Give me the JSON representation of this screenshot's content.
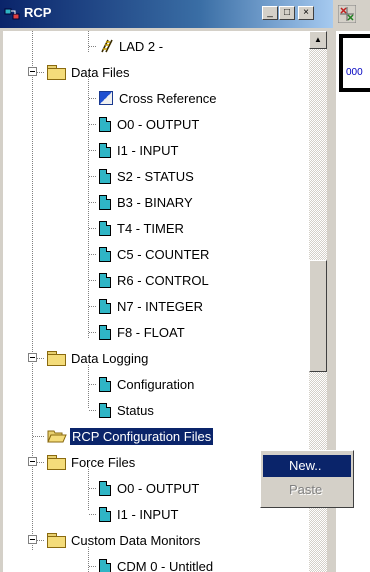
{
  "window": {
    "title": "RCP",
    "minimize_label": "_",
    "maximize_label": "□",
    "close_label": "×"
  },
  "tree": {
    "items": [
      {
        "label": "LAD 2 -",
        "icon": "ladder-icon"
      },
      {
        "label": "Data Files",
        "icon": "folder-icon"
      },
      {
        "label": "Cross Reference",
        "icon": "cross-reference-icon"
      },
      {
        "label": "O0 - OUTPUT",
        "icon": "data-file-icon"
      },
      {
        "label": "I1 - INPUT",
        "icon": "data-file-icon"
      },
      {
        "label": "S2 - STATUS",
        "icon": "data-file-icon"
      },
      {
        "label": "B3 - BINARY",
        "icon": "data-file-icon"
      },
      {
        "label": "T4 - TIMER",
        "icon": "data-file-icon"
      },
      {
        "label": "C5 - COUNTER",
        "icon": "data-file-icon"
      },
      {
        "label": "R6 - CONTROL",
        "icon": "data-file-icon"
      },
      {
        "label": "N7 - INTEGER",
        "icon": "data-file-icon"
      },
      {
        "label": "F8 - FLOAT",
        "icon": "data-file-icon"
      },
      {
        "label": "Data Logging",
        "icon": "folder-icon"
      },
      {
        "label": "Configuration",
        "icon": "data-file-icon"
      },
      {
        "label": "Status",
        "icon": "data-file-icon"
      },
      {
        "label": "RCP Configuration Files",
        "icon": "open-folder-icon"
      },
      {
        "label": "Force Files",
        "icon": "folder-icon"
      },
      {
        "label": "O0 - OUTPUT",
        "icon": "data-file-icon"
      },
      {
        "label": "I1 - INPUT",
        "icon": "data-file-icon"
      },
      {
        "label": "Custom Data Monitors",
        "icon": "folder-icon"
      },
      {
        "label": "CDM 0 - Untitled",
        "icon": "data-file-icon"
      }
    ]
  },
  "right_panel": {
    "address_text": "000"
  },
  "context_menu": {
    "items": [
      {
        "label": "New..",
        "enabled": true,
        "highlighted": true
      },
      {
        "label": "Paste",
        "enabled": false
      }
    ]
  },
  "colors": {
    "selection": "#0a246a",
    "face": "#d4d0c8",
    "data_file_icon": "#2fb5c5"
  }
}
